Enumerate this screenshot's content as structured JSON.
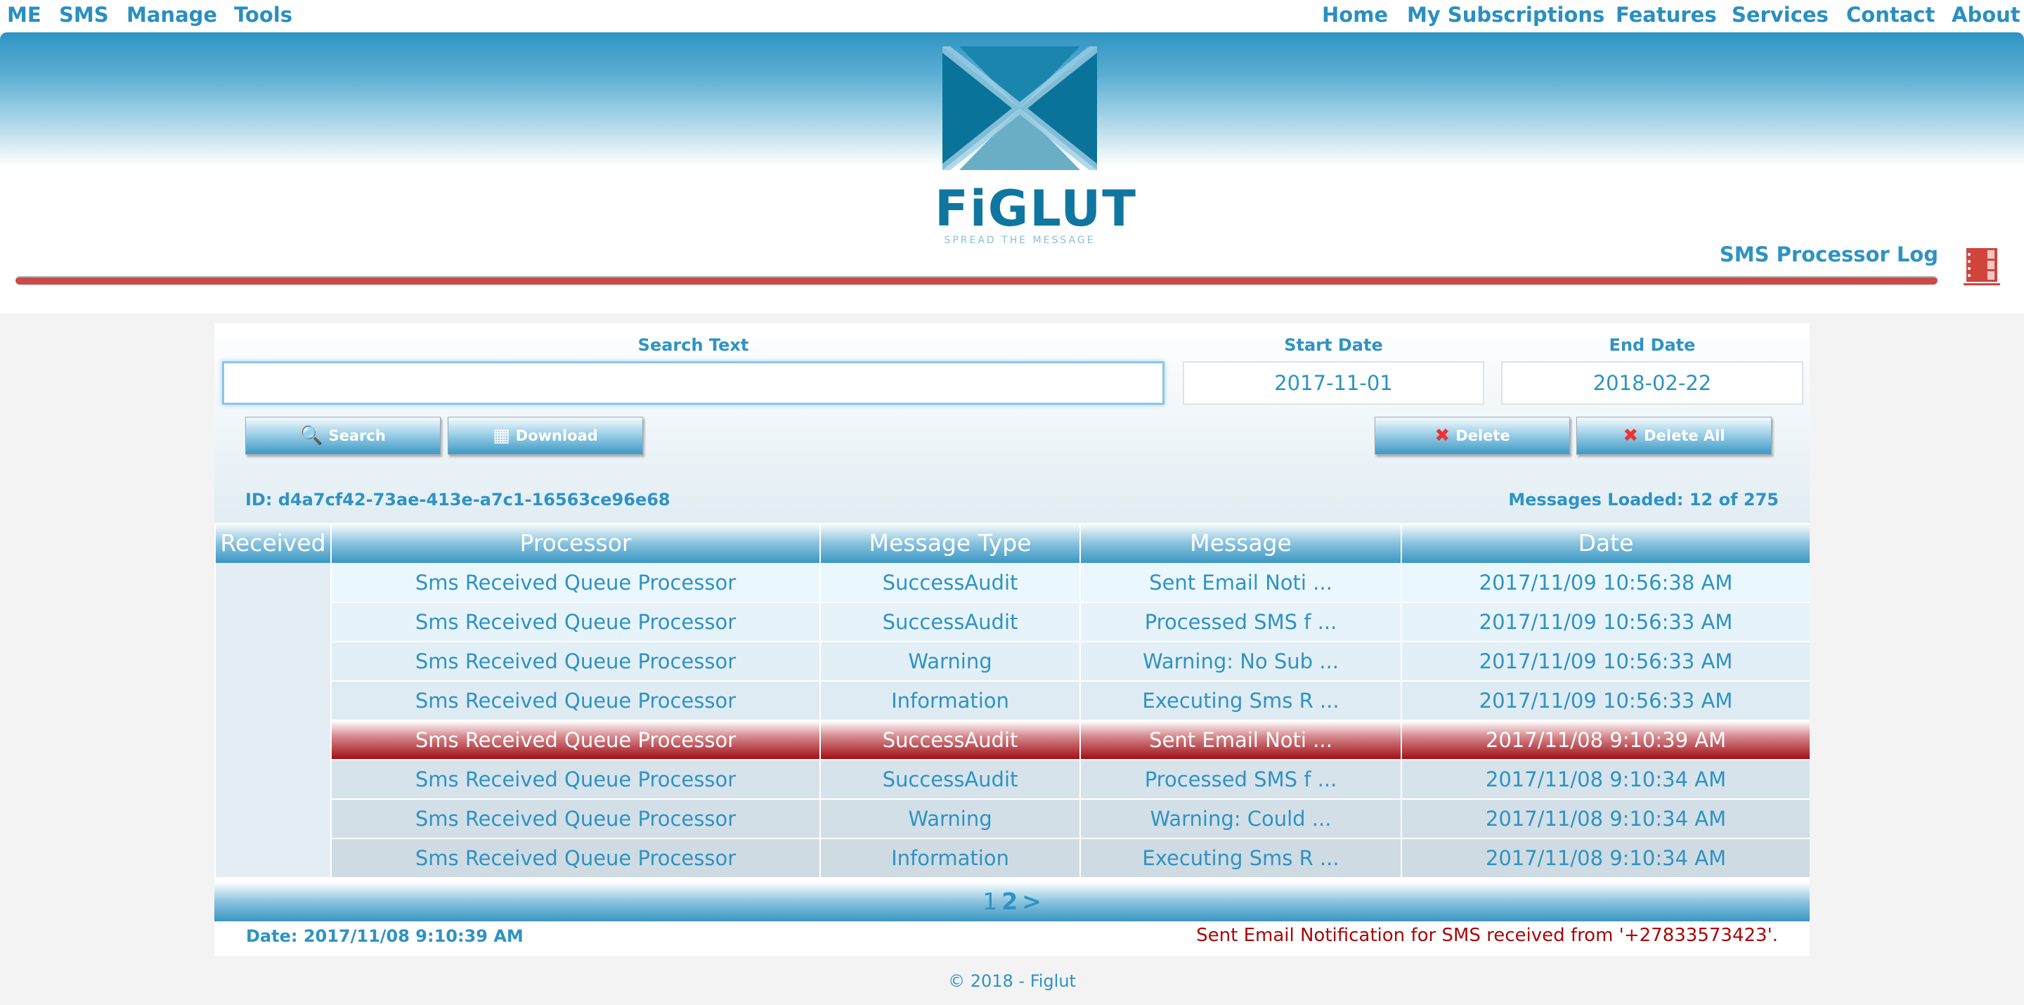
{
  "nav": {
    "left": [
      "ME",
      "SMS",
      "Manage",
      "Tools"
    ],
    "right": [
      "Home",
      "My Subscriptions",
      "Features",
      "Services",
      "Contact",
      "About"
    ]
  },
  "brand": {
    "name": "FiGLUT",
    "tagline": "SPREAD THE MESSAGE"
  },
  "page_title": "SMS Processor Log",
  "search": {
    "label": "Search Text",
    "value": "",
    "start_label": "Start Date",
    "start_value": "2017-11-01",
    "end_label": "End Date",
    "end_value": "2018-02-22"
  },
  "buttons": {
    "search": "Search",
    "download": "Download",
    "delete": "Delete",
    "delete_all": "Delete All"
  },
  "id_text": "ID: d4a7cf42-73ae-413e-a7c1-16563ce96e68",
  "loaded_text": "Messages Loaded: 12 of 275",
  "table": {
    "headers": [
      "Received",
      "Processor",
      "Message Type",
      "Message",
      "Date"
    ],
    "rows": [
      [
        "",
        "Sms Received Queue Processor",
        "SuccessAudit",
        "Sent Email Noti ...",
        "2017/11/09 10:56:38 AM"
      ],
      [
        "",
        "Sms Received Queue Processor",
        "SuccessAudit",
        "Processed SMS f ...",
        "2017/11/09 10:56:33 AM"
      ],
      [
        "",
        "Sms Received Queue Processor",
        "Warning",
        "Warning: No Sub ...",
        "2017/11/09 10:56:33 AM"
      ],
      [
        "",
        "Sms Received Queue Processor",
        "Information",
        "Executing Sms R ...",
        "2017/11/09 10:56:33 AM"
      ],
      [
        "",
        "Sms Received Queue Processor",
        "SuccessAudit",
        "Sent Email Noti ...",
        "2017/11/08 9:10:39 AM"
      ],
      [
        "",
        "Sms Received Queue Processor",
        "SuccessAudit",
        "Processed SMS f ...",
        "2017/11/08 9:10:34 AM"
      ],
      [
        "",
        "Sms Received Queue Processor",
        "Warning",
        "Warning: Could ...",
        "2017/11/08 9:10:34 AM"
      ],
      [
        "",
        "Sms Received Queue Processor",
        "Information",
        "Executing Sms R ...",
        "2017/11/08 9:10:34 AM"
      ]
    ],
    "selected_row": 4
  },
  "pager": {
    "pages": [
      "1",
      "2"
    ],
    "current": "2",
    "next": ">"
  },
  "detail": {
    "date": "Date: 2017/11/08 9:10:39 AM",
    "message": "Sent Email Notification for SMS received from '+27833573423'."
  },
  "footer": "© 2018 - Figlut",
  "colors": {
    "accent": "#2e93c3",
    "selected": "#a30e14",
    "bar": "#c94a4a"
  }
}
